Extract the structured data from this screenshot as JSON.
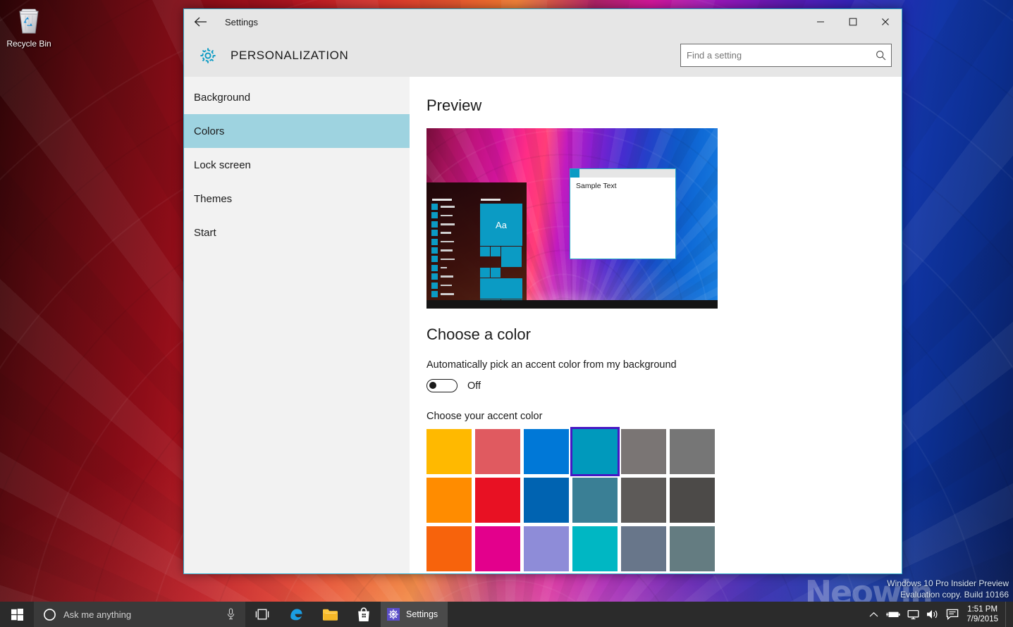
{
  "desktop": {
    "icons": [
      {
        "name": "recycle-bin",
        "label": "Recycle Bin"
      }
    ],
    "watermark": {
      "line1": "Windows 10 Pro Insider Preview",
      "line2": "Evaluation copy. Build 10166",
      "overlay_logo": "Neowin"
    }
  },
  "window": {
    "titlebar": {
      "back_label": "←",
      "title": "Settings",
      "minimize_label": "─",
      "maximize_label": "□",
      "close_label": "✕"
    },
    "header": {
      "icon": "gear-icon",
      "page_title": "PERSONALIZATION",
      "accent_color": "#0b9bc4"
    },
    "search": {
      "placeholder": "Find a setting",
      "value": "",
      "icon": "search-icon"
    },
    "sidebar": {
      "items": [
        {
          "label": "Background",
          "selected": false
        },
        {
          "label": "Colors",
          "selected": true
        },
        {
          "label": "Lock screen",
          "selected": false
        },
        {
          "label": "Themes",
          "selected": false
        },
        {
          "label": "Start",
          "selected": false
        }
      ],
      "selected_bg": "#9ed3e0"
    },
    "content": {
      "preview_heading": "Preview",
      "preview": {
        "tile_text": "Aa",
        "sample_window_text": "Sample Text",
        "accent_color": "#0b9bc4"
      },
      "choose_color_heading": "Choose a color",
      "auto_accent_label": "Automatically pick an accent color from my background",
      "auto_accent_state": "Off",
      "auto_accent_on": false,
      "accent_picker_label": "Choose your accent color",
      "selected_swatch_index": 3,
      "selection_outline_color": "#4617c4",
      "swatches": [
        "#ffb900",
        "#e05a60",
        "#0078d7",
        "#0099bc",
        "#7a7574",
        "#767676",
        "#ff8c00",
        "#e81123",
        "#0063b1",
        "#3a7f95",
        "#5d5a58",
        "#4c4a48",
        "#f7630c",
        "#e3008c",
        "#8e8cd8",
        "#00b7c3",
        "#68768a",
        "#647c81",
        "#ca5010",
        "#bf0077",
        "#6b69d6",
        "#038387",
        "#515c6b",
        "#4a5459"
      ]
    }
  },
  "taskbar": {
    "start_label": "Start",
    "search": {
      "placeholder": "Ask me anything",
      "cortana_icon": "cortana-circle-icon",
      "mic_icon": "microphone-icon"
    },
    "buttons": [
      {
        "name": "task-view",
        "icon": "task-view-icon"
      },
      {
        "name": "edge",
        "icon": "edge-icon",
        "color": "#1b9de2"
      },
      {
        "name": "file-explorer",
        "icon": "folder-icon",
        "color": "#ffc83d"
      },
      {
        "name": "store",
        "icon": "store-bag-icon",
        "color": "#ffffff"
      }
    ],
    "active_task": {
      "label": "Settings",
      "icon_color": "#5c4fc9"
    },
    "tray": [
      {
        "name": "show-hidden-icons",
        "icon": "chevron-up-icon"
      },
      {
        "name": "battery",
        "icon": "battery-icon"
      },
      {
        "name": "network",
        "icon": "network-monitor-icon"
      },
      {
        "name": "volume",
        "icon": "speaker-icon"
      },
      {
        "name": "action-center",
        "icon": "notification-icon"
      }
    ],
    "clock": {
      "time": "1:51 PM",
      "date": "7/9/2015"
    }
  }
}
